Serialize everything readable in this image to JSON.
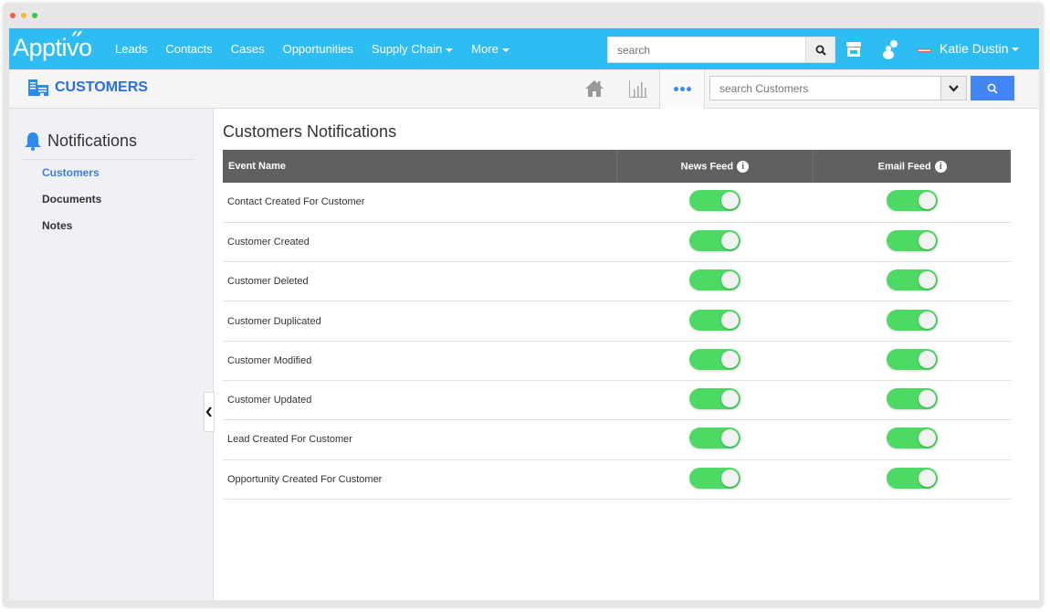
{
  "window": {
    "controls": [
      "close",
      "minimize",
      "maximize"
    ]
  },
  "topnav": {
    "logo": "Apptivo",
    "links": [
      {
        "label": "Leads",
        "dropdown": false
      },
      {
        "label": "Contacts",
        "dropdown": false
      },
      {
        "label": "Cases",
        "dropdown": false
      },
      {
        "label": "Opportunities",
        "dropdown": false
      },
      {
        "label": "Supply Chain",
        "dropdown": true
      },
      {
        "label": "More",
        "dropdown": true
      }
    ],
    "search_placeholder": "search",
    "icons": [
      "search-icon",
      "store-icon",
      "person-icon",
      "flag-icon"
    ],
    "user_name": "Katie Dustin"
  },
  "subbar": {
    "module_title": "CUSTOMERS",
    "icons": [
      "home-icon",
      "bar-chart-icon",
      "more-icon"
    ],
    "search_placeholder": "search Customers"
  },
  "sidebar": {
    "heading": "Notifications",
    "items": [
      {
        "label": "Customers",
        "active": true
      },
      {
        "label": "Documents",
        "active": false
      },
      {
        "label": "Notes",
        "active": false
      }
    ]
  },
  "main": {
    "title": "Customers Notifications",
    "columns": [
      "Event Name",
      "News Feed",
      "Email Feed"
    ],
    "rows": [
      {
        "event": "Contact Created For Customer",
        "news_feed": true,
        "email_feed": true
      },
      {
        "event": "Customer Created",
        "news_feed": true,
        "email_feed": true
      },
      {
        "event": "Customer Deleted",
        "news_feed": true,
        "email_feed": true
      },
      {
        "event": "Customer Duplicated",
        "news_feed": true,
        "email_feed": true
      },
      {
        "event": "Customer Modified",
        "news_feed": true,
        "email_feed": true
      },
      {
        "event": "Customer Updated",
        "news_feed": true,
        "email_feed": true
      },
      {
        "event": "Lead Created For Customer",
        "news_feed": true,
        "email_feed": true
      },
      {
        "event": "Opportunity Created For Customer",
        "news_feed": true,
        "email_feed": true
      }
    ]
  },
  "colors": {
    "topnav_bg": "#2ebdf3",
    "accent_blue": "#3c7fe0",
    "search_button": "#4285f4",
    "table_header": "#606060",
    "toggle_on": "#4cd964"
  }
}
